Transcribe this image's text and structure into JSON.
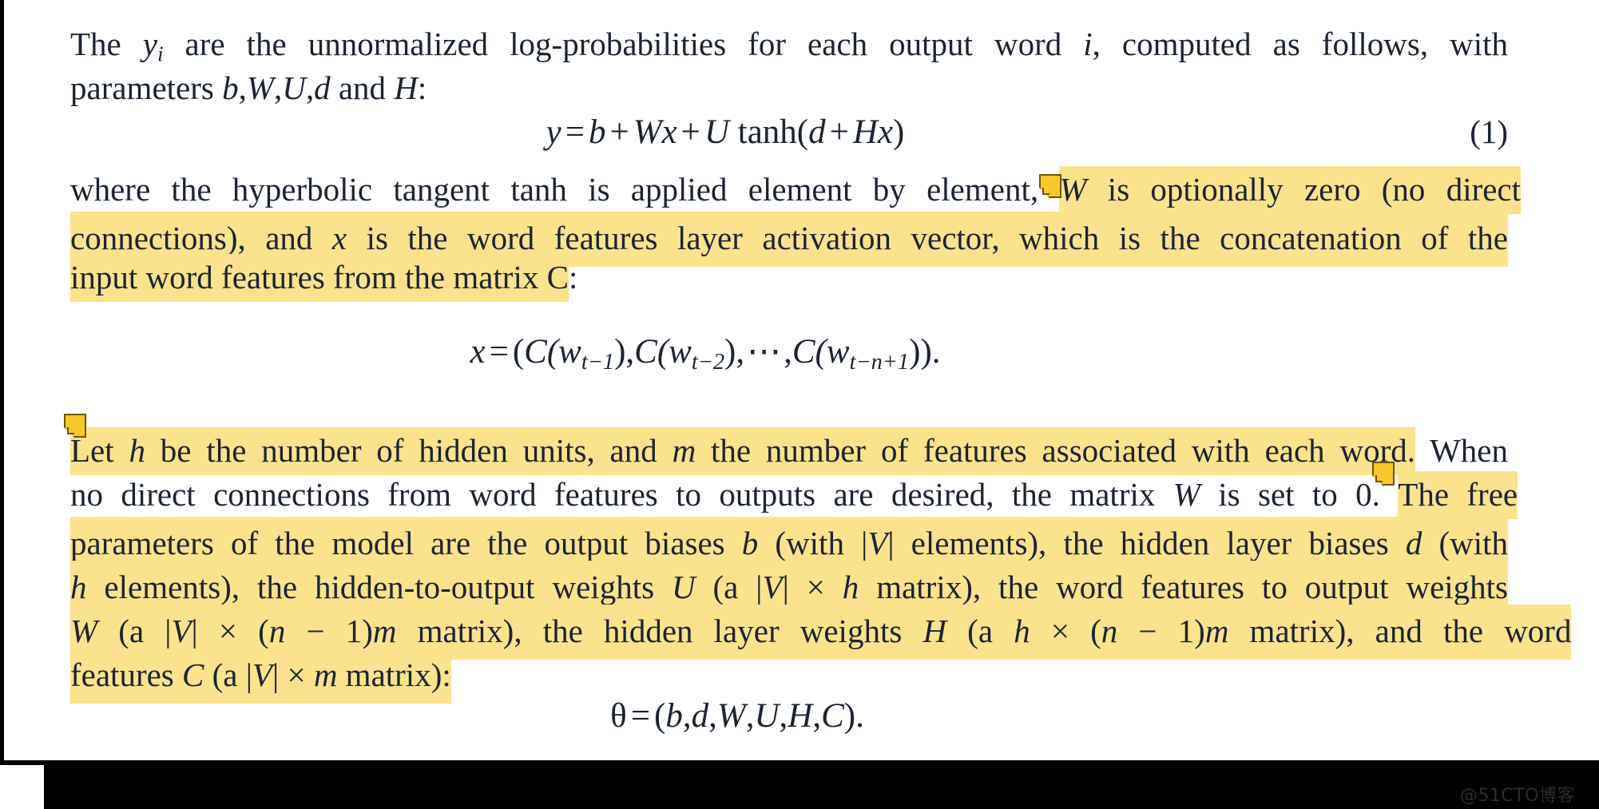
{
  "document": {
    "type": "paper-excerpt",
    "font_style": "serif",
    "colors": {
      "page_background": "#ffffff",
      "text": "#1b2433",
      "highlight": "#fbe28d",
      "note_fill": "#f7c82a",
      "note_border": "#6e5405",
      "chrome": "#000000",
      "watermark": "#2c2c2c"
    }
  },
  "paragraph1": {
    "line1": {
      "a": "The ",
      "yi": "y",
      "yi_sub": "i",
      "b": " are the unnormalized log-probabilities for each output word ",
      "i_var": "i",
      "c": ", computed as follows, with"
    },
    "line2": {
      "a": "parameters ",
      "b_var": "b",
      "comma1": ",",
      "W_var": "W",
      "comma2": ",",
      "U_var": "U",
      "comma3": ",",
      "d_var": "d",
      "b": " and ",
      "H_var": "H",
      "c": ":"
    }
  },
  "equation1": {
    "lhs": "y",
    "eq": "=",
    "t1": "b",
    "plus1": "+",
    "t2a": "W",
    "t2b": "x",
    "plus2": "+",
    "t3": "U",
    "fn": "tanh",
    "open": "(",
    "t4": "d",
    "plus3": "+",
    "t5a": "H",
    "t5b": "x",
    "close": ")",
    "number": "(1)"
  },
  "paragraph2": {
    "line1": {
      "plain": "where the hyperbolic tangent tanh is applied element by element,",
      "highlighted_start": "W",
      "highlighted_rest": " is optionally zero (no direct"
    },
    "line2": "connections), and x is the word features layer activation vector, which is the concatenation of the",
    "line2_parts": {
      "a": "connections), and ",
      "x": "x",
      "b": " is the word features layer activation vector, which is the concatenation of the"
    },
    "line3": {
      "highlighted": "input word features from the matrix C",
      "trailing": ":"
    }
  },
  "equation2": {
    "lhs": "x",
    "eq": "=",
    "body_open": "(",
    "c1": "C(w",
    "c1_sub": "t−1",
    "c1_close": ")",
    "sep1": ",",
    "c2": "C(w",
    "c2_sub": "t−2",
    "c2_close": ")",
    "sep2": ",",
    "dots": "⋯",
    "sep3": ",",
    "c3": "C(w",
    "c3_sub": "t−n+1",
    "c3_close": ")",
    "body_close": ")",
    "period": "."
  },
  "paragraph3": {
    "line1": {
      "highlighted_a": "Let ",
      "h": "h",
      "highlighted_b": " be the number of hidden units, and ",
      "m": "m",
      "highlighted_c": " the number of features associated with each word.",
      "plain_tail": " When"
    },
    "line2": {
      "plain": "no direct connections from word features to outputs are desired, the matrix W is set to 0.",
      "plain_parts": {
        "a": "no direct connections from word features to outputs are desired, the matrix ",
        "W": "W",
        "b": " is set to 0."
      },
      "highlighted_tail": "The free"
    },
    "line3": {
      "a": "parameters of the model are the output biases ",
      "b": "b",
      "c": " (with |",
      "V": "V",
      "d": "| elements), the hidden layer biases ",
      "e": "d",
      "f": " (with"
    },
    "line4": {
      "h": "h",
      "a": " elements), the hidden-to-output weights ",
      "U": "U",
      "b": " (a |",
      "V": "V",
      "c": "| ",
      "times": "×",
      "d": " ",
      "hh": "h",
      "e": " matrix), the word features to output weights"
    },
    "line5": {
      "W": "W",
      "a": " (a |",
      "V": "V",
      "b": "| ",
      "times1": "×",
      "c": " (",
      "n": "n",
      "minus": "−",
      "one": "1",
      "d": ")",
      "m": "m",
      "e": " matrix), the hidden layer weights ",
      "H": "H",
      "f": " (a ",
      "hh": "h",
      "times2": "×",
      "g": " (",
      "n2": "n",
      "minus2": "−",
      "one2": "1",
      "h2": ")",
      "m2": "m",
      "i": " matrix), and the word"
    },
    "line6": {
      "a": "features ",
      "C": "C",
      "b": " (a |",
      "V": "V",
      "c": "| ",
      "times": "×",
      "d": " ",
      "m": "m",
      "e": " matrix):"
    }
  },
  "equation3": {
    "theta": "θ",
    "eq": "=",
    "open": "(",
    "b": "b",
    "c1": ",",
    "d": "d",
    "c2": ",",
    "W": "W",
    "c3": ",",
    "U": "U",
    "c4": ",",
    "H": "H",
    "c5": ",",
    "C": "C",
    "close": ")",
    "period": "."
  },
  "annotations": {
    "notes": [
      {
        "id": "note-1",
        "anchor": "W is optionally zero"
      },
      {
        "id": "note-2",
        "anchor": "Let h be the number of hidden units"
      },
      {
        "id": "note-3",
        "anchor": "The free parameters of the model"
      }
    ]
  },
  "watermark": {
    "text": "@51CTO博客"
  }
}
